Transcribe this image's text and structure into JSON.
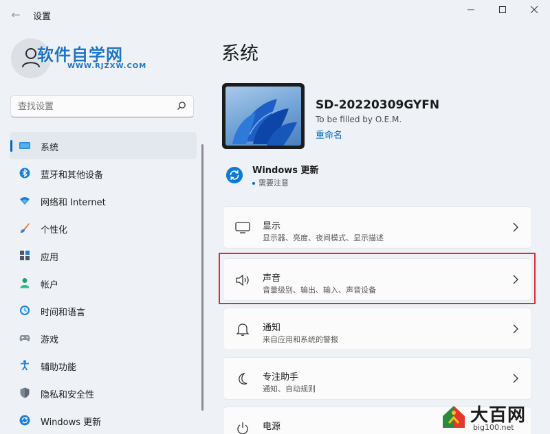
{
  "window": {
    "title": "设置",
    "back_glyph": "←",
    "minimize_glyph": "—",
    "maximize_glyph": "☐",
    "close_glyph": "✕"
  },
  "profile": {
    "avatar_icon": "user-icon",
    "watermark_text": "软件自学网",
    "watermark_url": "WWW.RJZXW.COM"
  },
  "search": {
    "placeholder": "查找设置",
    "icon": "search-icon"
  },
  "sidebar": {
    "items": [
      {
        "label": "系统",
        "icon": "system-display-icon",
        "active": true
      },
      {
        "label": "蓝牙和其他设备",
        "icon": "bluetooth-icon"
      },
      {
        "label": "网络和 Internet",
        "icon": "wifi-icon"
      },
      {
        "label": "个性化",
        "icon": "brush-icon"
      },
      {
        "label": "应用",
        "icon": "apps-icon"
      },
      {
        "label": "帐户",
        "icon": "account-icon"
      },
      {
        "label": "时间和语言",
        "icon": "time-language-icon"
      },
      {
        "label": "游戏",
        "icon": "gamepad-icon"
      },
      {
        "label": "辅助功能",
        "icon": "accessibility-icon"
      },
      {
        "label": "隐私和安全性",
        "icon": "shield-icon"
      },
      {
        "label": "Windows 更新",
        "icon": "windows-update-icon"
      }
    ]
  },
  "main": {
    "title": "系统",
    "device": {
      "name": "SD-20220309GYFN",
      "model": "To be filled by O.E.M.",
      "rename": "重命名"
    },
    "update": {
      "title": "Windows 更新",
      "status": "需要注意"
    },
    "cards": [
      {
        "title": "显示",
        "desc": "显示器、亮度、夜间模式、显示描述",
        "icon": "monitor-icon"
      },
      {
        "title": "声音",
        "desc": "音量级别、输出、输入、声音设备",
        "icon": "speaker-icon",
        "highlighted": true
      },
      {
        "title": "通知",
        "desc": "来自应用和系统的警报",
        "icon": "bell-icon"
      },
      {
        "title": "专注助手",
        "desc": "通知、自动规则",
        "icon": "moon-icon"
      },
      {
        "title": "电源",
        "desc": "",
        "icon": "power-icon"
      }
    ]
  },
  "corner_logo": {
    "text": "大百网",
    "url": "big100.net"
  },
  "colors": {
    "accent": "#0067c0",
    "highlight_border": "#e22b2b",
    "background": "#eef2f7"
  }
}
